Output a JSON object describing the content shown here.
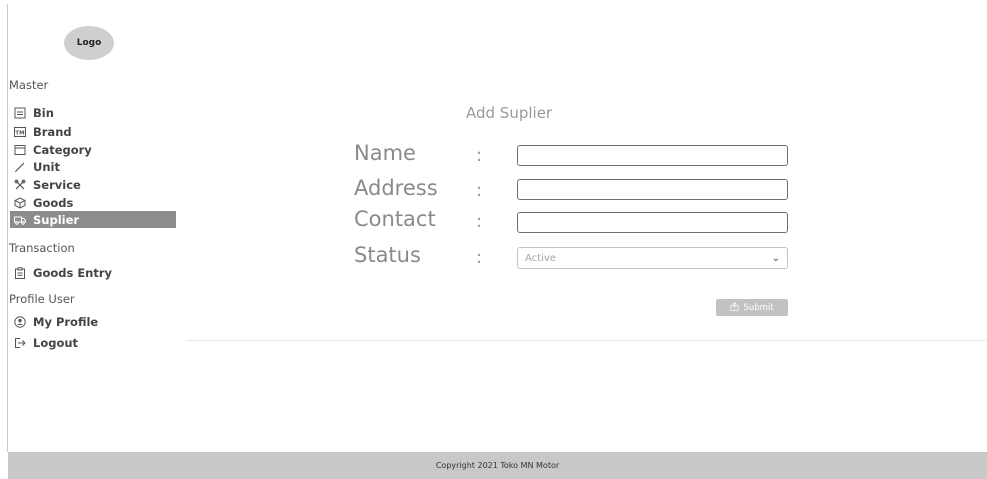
{
  "logo": {
    "text": "Logo"
  },
  "sidebar": {
    "sections": [
      {
        "title": "Master"
      },
      {
        "title": "Transaction"
      },
      {
        "title": "Profile User"
      }
    ],
    "items": [
      {
        "label": "Bin",
        "icon": "bin-icon"
      },
      {
        "label": "Brand",
        "icon": "trademark-icon"
      },
      {
        "label": "Category",
        "icon": "category-icon"
      },
      {
        "label": "Unit",
        "icon": "pencil-icon"
      },
      {
        "label": "Service",
        "icon": "tools-icon"
      },
      {
        "label": "Goods",
        "icon": "box-icon"
      },
      {
        "label": "Suplier",
        "icon": "truck-icon",
        "active": true
      },
      {
        "label": "Goods Entry",
        "icon": "clipboard-icon"
      },
      {
        "label": "My Profile",
        "icon": "user-circle-icon"
      },
      {
        "label": "Logout",
        "icon": "logout-icon"
      }
    ]
  },
  "form": {
    "title": "Add Suplier",
    "colon": ":",
    "fields": {
      "name": {
        "label": "Name",
        "value": ""
      },
      "address": {
        "label": "Address",
        "value": ""
      },
      "contact": {
        "label": "Contact",
        "value": ""
      },
      "status": {
        "label": "Status",
        "selected": "Active"
      }
    },
    "submit_label": "Submit"
  },
  "footer": {
    "text": "Copyright 2021 Toko MN Motor"
  },
  "colors": {
    "active_bg": "#8c8c8c",
    "footer_bg": "#c8c8c8",
    "button_bg": "#c2c2c2"
  }
}
